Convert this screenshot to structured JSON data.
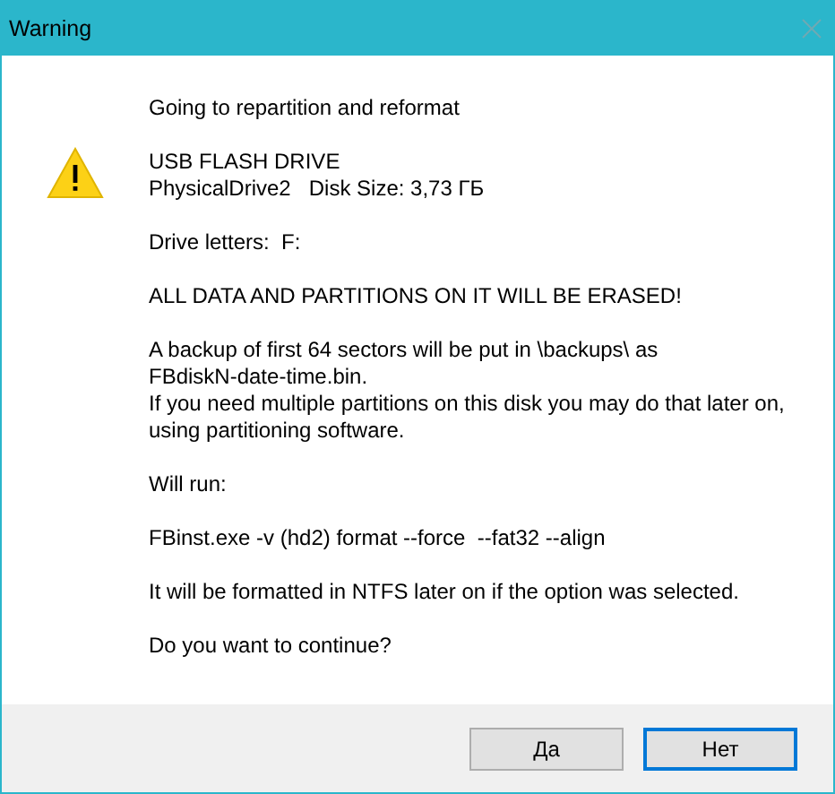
{
  "window": {
    "title": "Warning"
  },
  "message": [
    {
      "lines": [
        "Going to repartition and reformat"
      ]
    },
    {
      "lines": [
        "USB FLASH DRIVE",
        "PhysicalDrive2   Disk Size: 3,73 ГБ"
      ]
    },
    {
      "lines": [
        "Drive letters:  F:"
      ]
    },
    {
      "lines": [
        "ALL DATA AND PARTITIONS ON IT WILL BE ERASED!"
      ]
    },
    {
      "lines": [
        "A backup of first 64 sectors will be put in \\backups\\ as",
        "FBdiskN-date-time.bin.",
        "If you need multiple partitions on this disk you may do that later on,",
        "using partitioning software."
      ]
    },
    {
      "lines": [
        "Will run:"
      ]
    },
    {
      "lines": [
        "FBinst.exe -v (hd2) format --force  --fat32 --align"
      ]
    },
    {
      "lines": [
        "It will be formatted in NTFS later on if the option was selected."
      ]
    },
    {
      "lines": [
        "Do you want to continue?"
      ]
    }
  ],
  "buttons": [
    {
      "label": "Да",
      "focused": false
    },
    {
      "label": "Нет",
      "focused": true
    }
  ]
}
